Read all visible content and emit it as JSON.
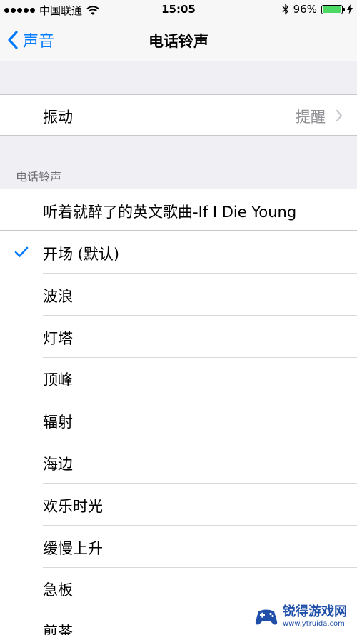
{
  "status_bar": {
    "carrier": "中国联通",
    "time": "15:05",
    "battery_percent": "96%",
    "battery_level": 0.96,
    "signal_dots": 5,
    "icons": [
      "signal-dots-icon",
      "wifi-icon",
      "bluetooth-icon",
      "battery-icon",
      "charging-bolt-icon"
    ]
  },
  "nav": {
    "back_label": "声音",
    "title": "电话铃声",
    "accent_color": "#007aff"
  },
  "vibration": {
    "label": "振动",
    "value": "提醒"
  },
  "ringtone_section": {
    "header": "电话铃声",
    "custom_song": "听着就醉了的英文歌曲-If I Die Young",
    "selected_index": 0,
    "tones": [
      "开场 (默认)",
      "波浪",
      "灯塔",
      "顶峰",
      "辐射",
      "海边",
      "欢乐时光",
      "缓慢上升",
      "急板",
      "煎茶"
    ]
  },
  "watermark": {
    "name": "锐得游戏网",
    "url": "www.ytruida.com"
  }
}
